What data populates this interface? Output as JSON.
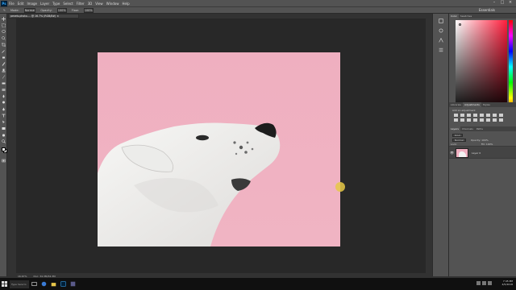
{
  "menu": {
    "logo": "Ps",
    "items": [
      "File",
      "Edit",
      "Image",
      "Layer",
      "Type",
      "Select",
      "Filter",
      "3D",
      "View",
      "Window",
      "Help"
    ],
    "window_controls": [
      "–",
      "□",
      "×"
    ]
  },
  "options_bar": {
    "labels": [
      "Mode:",
      "Normal",
      "Opacity:",
      "100%",
      "Flow:",
      "100%"
    ],
    "workspace": "Essentials"
  },
  "document_tab": "pexels-photo-... @ 16.7% (RGB/8#) ×",
  "status": {
    "zoom": "16.67%",
    "doc_info": "Doc: 34.3M/34.3M"
  },
  "panels": {
    "color_tabs": [
      "Color",
      "Swatches"
    ],
    "adjustments_tabs": [
      "Libraries",
      "Adjustments",
      "Styles"
    ],
    "adjustments_hint": "Add an adjustment",
    "layers_tabs": [
      "Layers",
      "Channels",
      "Paths"
    ],
    "layers_kind": "Kind",
    "layers_blend": "Normal",
    "layers_opacity": "Opacity: 100%",
    "layers_fill": "Fill: 100%",
    "layers_lock": "Lock:",
    "layer_name": "Layer 0"
  },
  "taskbar": {
    "search": "Type here to search",
    "time": "7:45 PM",
    "date": "4/5/2018"
  },
  "colors": {
    "canvas_pink": "#efafc0",
    "dog_white": "#f1f1f1",
    "ps_dark": "#282828",
    "ps_panel": "#535353",
    "cursor_yellow": "#e6c846"
  }
}
